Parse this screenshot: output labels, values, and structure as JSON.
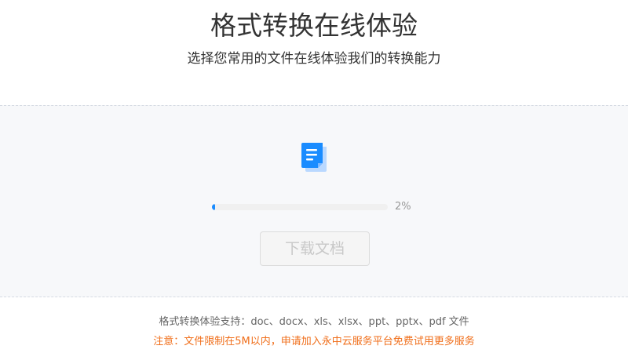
{
  "header": {
    "title": "格式转换在线体验",
    "subtitle": "选择您常用的文件在线体验我们的转换能力"
  },
  "converter": {
    "icon": "document-icon",
    "progress_percent": 2,
    "progress_label": "2%",
    "download_label": "下载文档"
  },
  "footer": {
    "support_text": "格式转换体验支持：doc、docx、xls、xlsx、ppt、pptx、pdf 文件",
    "note_text": "注意：文件限制在5M以内，申请加入永中云服务平台免费试用更多服务"
  },
  "colors": {
    "accent": "#1a8cff",
    "note": "#f06e1a",
    "panel_bg": "#f7f8fa"
  }
}
